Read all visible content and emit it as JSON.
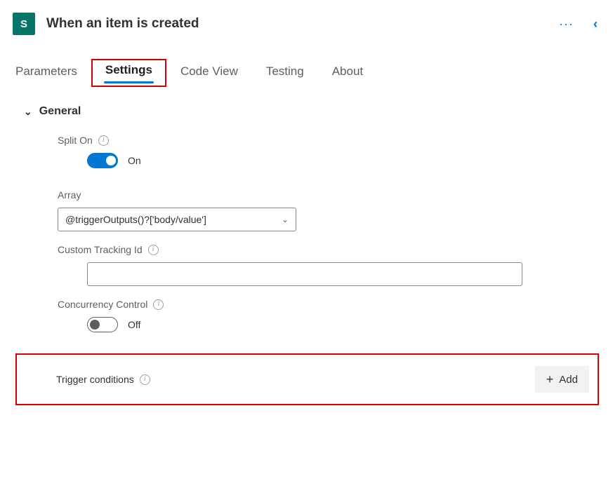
{
  "header": {
    "icon_glyph": "S",
    "title": "When an item is created"
  },
  "tabs": [
    "Parameters",
    "Settings",
    "Code View",
    "Testing",
    "About"
  ],
  "active_tab": "Settings",
  "section": {
    "title": "General",
    "fields": {
      "split_on": {
        "label": "Split On",
        "value": true,
        "value_label": "On"
      },
      "array": {
        "label": "Array",
        "selected": "@triggerOutputs()?['body/value']"
      },
      "custom_tracking": {
        "label": "Custom Tracking Id",
        "value": ""
      },
      "concurrency": {
        "label": "Concurrency Control",
        "value": false,
        "value_label": "Off"
      },
      "trigger_conditions": {
        "label": "Trigger conditions",
        "add_label": "Add"
      }
    }
  }
}
